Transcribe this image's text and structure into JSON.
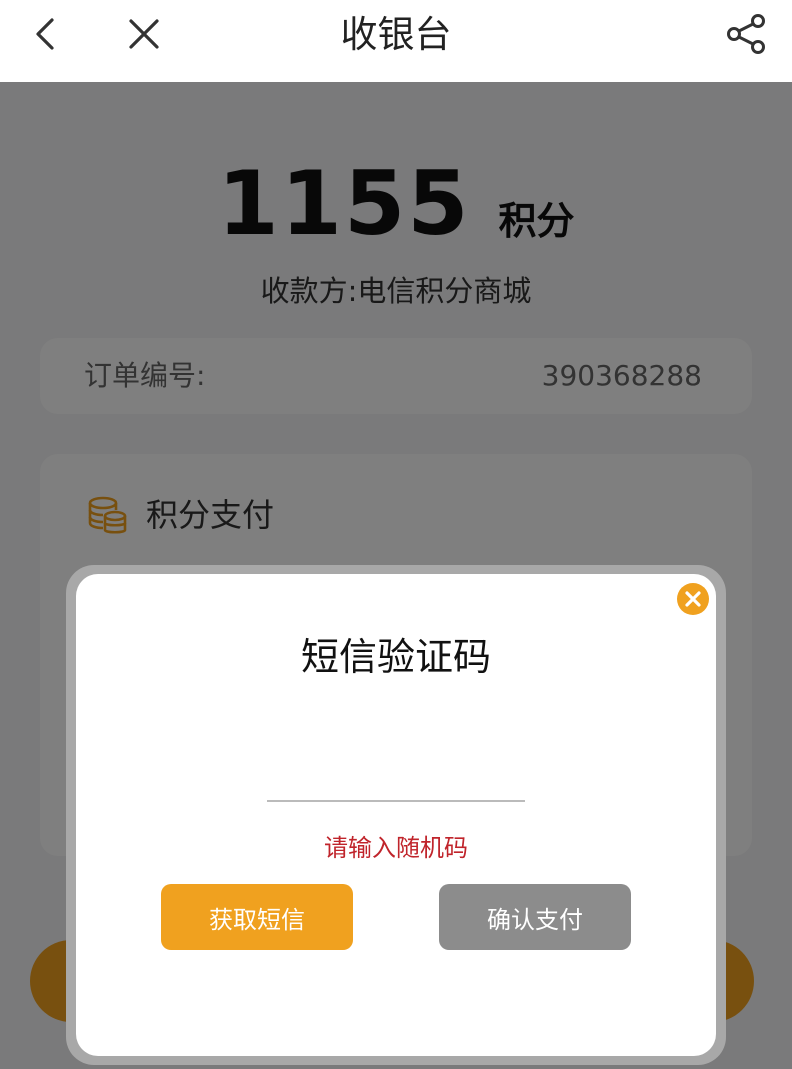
{
  "header": {
    "title": "收银台",
    "back_icon": "chevron-left-icon",
    "close_icon": "close-icon",
    "share_icon": "share-icon"
  },
  "payment": {
    "amount": "1155",
    "unit": "积分",
    "payee": "收款方:电信积分商城",
    "order_label": "订单编号:",
    "order_number": "390368288",
    "method_title": "积分支付",
    "method_icon": "coins-icon"
  },
  "dialog": {
    "title": "短信验证码",
    "input_value": "",
    "hint": "请输入随机码",
    "get_sms_label": "获取短信",
    "confirm_label": "确认支付",
    "close_icon": "close-circle-icon"
  },
  "colors": {
    "accent": "#f0a11f",
    "hint_red": "#c0242b",
    "disabled_gray": "#8c8c8c"
  }
}
